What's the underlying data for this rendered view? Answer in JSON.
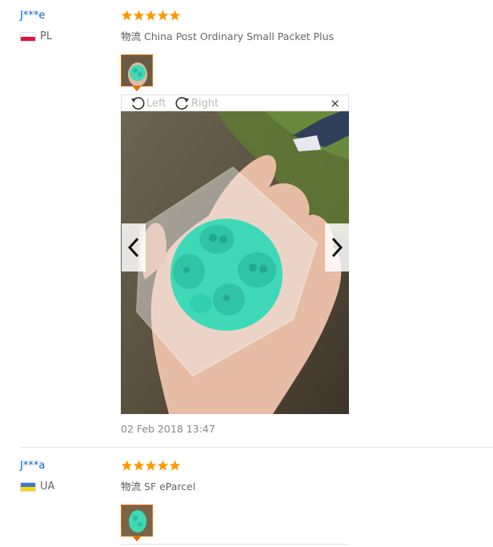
{
  "reviews": [
    {
      "user": "J***e",
      "country": "PL",
      "rating": 5,
      "shipping_label": "物流",
      "shipping_method": "China Post Ordinary Small Packet Plus",
      "viewer": {
        "rotate_left": "Left",
        "rotate_right": "Right",
        "close": "×"
      },
      "date": "02 Feb 2018 13:47"
    },
    {
      "user": "J***a",
      "country": "UA",
      "rating": 5,
      "shipping_label": "物流",
      "shipping_method": "SF eParcel"
    }
  ],
  "colors": {
    "link": "#0066cc",
    "star": "#ff9900",
    "thumb_border": "#e46c0a",
    "mold": "#3fd9b8"
  },
  "icons": {
    "star": "star-icon",
    "rotate_left": "rotate-left-icon",
    "rotate_right": "rotate-right-icon",
    "prev": "chevron-left-icon",
    "next": "chevron-right-icon",
    "close": "close-icon"
  }
}
